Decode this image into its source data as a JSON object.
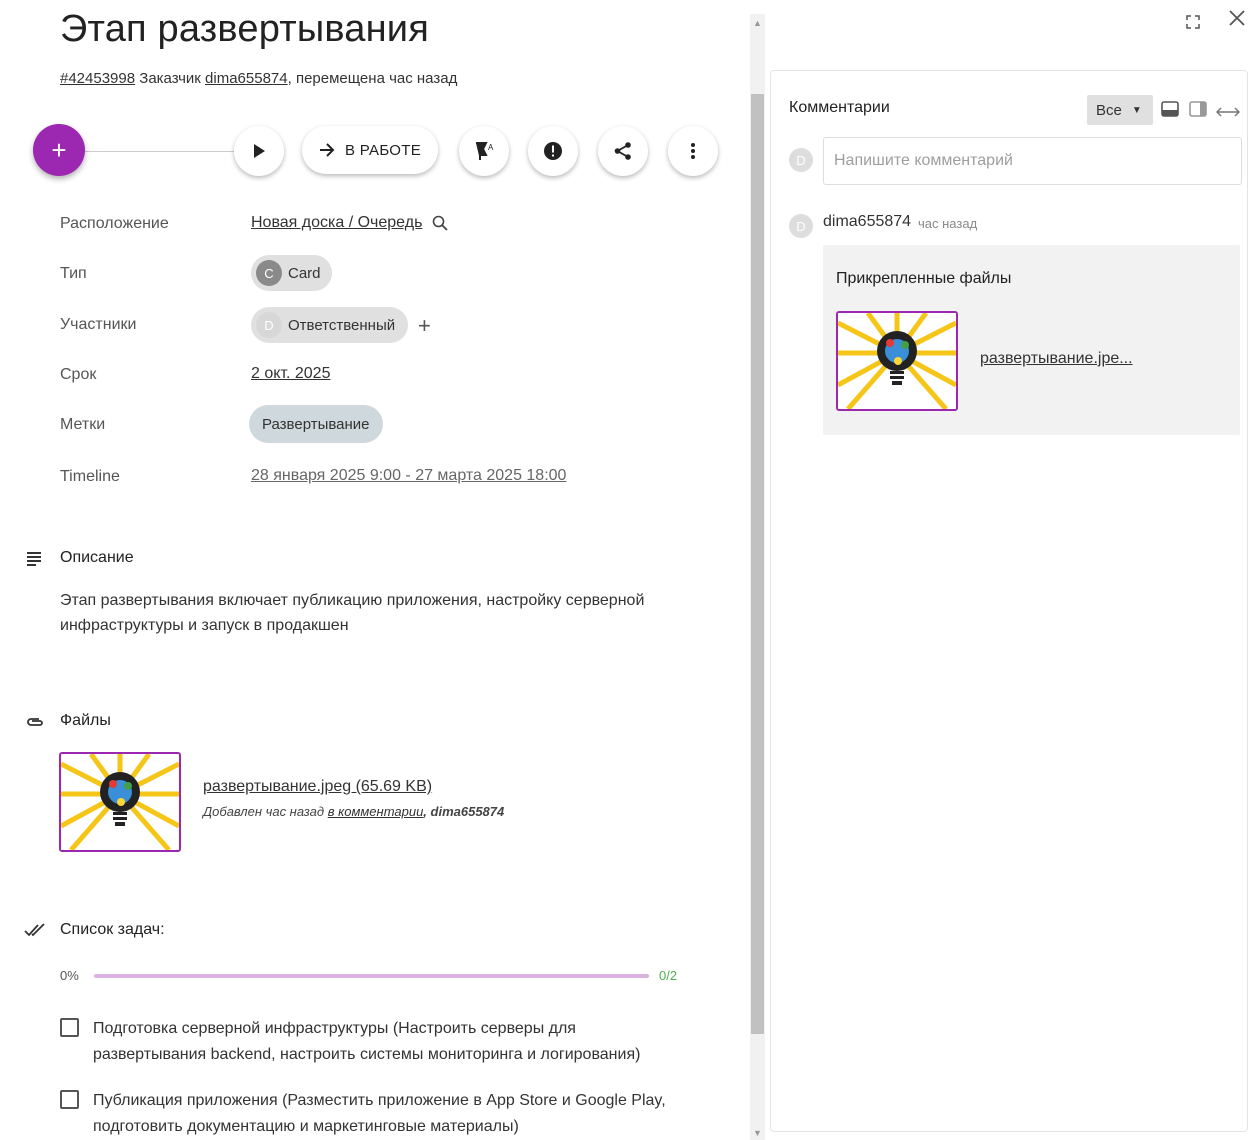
{
  "card": {
    "title": "Этап развертывания",
    "id": "#42453998",
    "customer_label": "Заказчик",
    "customer": "dima655874",
    "moved_text": ", перемещена час назад"
  },
  "actions": {
    "status_label": "В РАБОТЕ"
  },
  "properties": {
    "location_label": "Расположение",
    "location_value": "Новая доска / Очередь",
    "type_label": "Тип",
    "type_avatar": "C",
    "type_value": "Card",
    "members_label": "Участники",
    "member_avatar": "D",
    "member_value": "Ответственный",
    "due_label": "Срок",
    "due_value": "2 окт. 2025",
    "tags_label": "Метки",
    "tag_value": "Развертывание",
    "timeline_label": "Timeline",
    "timeline_value": "28 января 2025 9:00 - 27 марта 2025 18:00"
  },
  "description": {
    "title": "Описание",
    "text": "Этап развертывания включает публикацию приложения, настройку серверной инфраструктуры и запуск в продакшен"
  },
  "files": {
    "title": "Файлы",
    "name": "развертывание.jpeg (65.69 KB)",
    "added_prefix": "Добавлен час назад",
    "added_link": "в комментарии",
    "added_by": ", dima655874"
  },
  "checklist": {
    "title": "Список задач:",
    "percent_label": "0%",
    "progress": 0,
    "count": "0/2",
    "items": [
      {
        "text": "Подготовка серверной инфраструктуры (Настроить серверы для развертывания backend, настроить системы мониторинга и логирования)",
        "checked": false
      },
      {
        "text": "Публикация приложения (Разместить приложение в App Store и Google Play, подготовить документацию и маркетинговые материалы)",
        "checked": false
      }
    ]
  },
  "comments": {
    "title": "Комментарии",
    "filter_value": "Все",
    "input_avatar": "D",
    "input_placeholder": "Напишите комментарий",
    "entry": {
      "avatar": "D",
      "author": "dima655874",
      "time": "час назад",
      "attachments_title": "Прикрепленные файлы",
      "attachment_name": "развертывание.jpe..."
    }
  },
  "colors": {
    "accent": "#9c27b0",
    "chip": "#e0e0e0",
    "tag_chip": "#cfd8dc",
    "progress_count": "#4caf50"
  },
  "icons": {
    "add": "plus-icon",
    "play": "play-icon",
    "move": "arrow-right-icon",
    "priority": "flag-auto-icon",
    "alert": "exclamation-icon",
    "share": "share-icon",
    "more": "more-vert-icon",
    "search": "search-icon",
    "description": "subject-icon",
    "files": "attachment-icon",
    "checklist": "double-check-icon",
    "fullscreen": "fullscreen-icon",
    "close": "close-icon"
  }
}
